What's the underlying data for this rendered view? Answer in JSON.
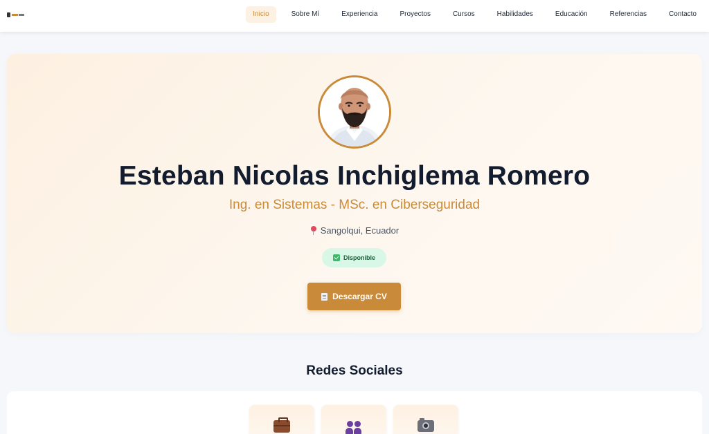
{
  "header": {
    "logo_icon": "brand-logo-icon",
    "nav": [
      {
        "label": "Inicio",
        "active": true
      },
      {
        "label": "Sobre Mí"
      },
      {
        "label": "Experiencia"
      },
      {
        "label": "Proyectos"
      },
      {
        "label": "Cursos"
      },
      {
        "label": "Habilidades"
      },
      {
        "label": "Educación"
      },
      {
        "label": "Referencias"
      },
      {
        "label": "Contacto"
      }
    ]
  },
  "hero": {
    "avatar_icon": "profile-photo",
    "name": "Esteban Nicolas Inchiglema Romero",
    "subtitle": "Ing. en Sistemas - MSc. en Ciberseguridad",
    "location_icon": "map-pin-icon",
    "location": "Sangolqui, Ecuador",
    "badge_icon": "check-box-icon",
    "badge": "Disponible",
    "cv_icon": "document-icon",
    "cv_button": "Descargar CV"
  },
  "social": {
    "title": "Redes Sociales",
    "cards": [
      {
        "icon": "briefcase-icon"
      },
      {
        "icon": "people-icon"
      },
      {
        "icon": "camera-icon"
      }
    ]
  },
  "colors": {
    "accent": "#c98a3a",
    "text_dark": "#121c2e",
    "badge_bg": "#d9f7e6",
    "badge_text": "#16673a"
  }
}
